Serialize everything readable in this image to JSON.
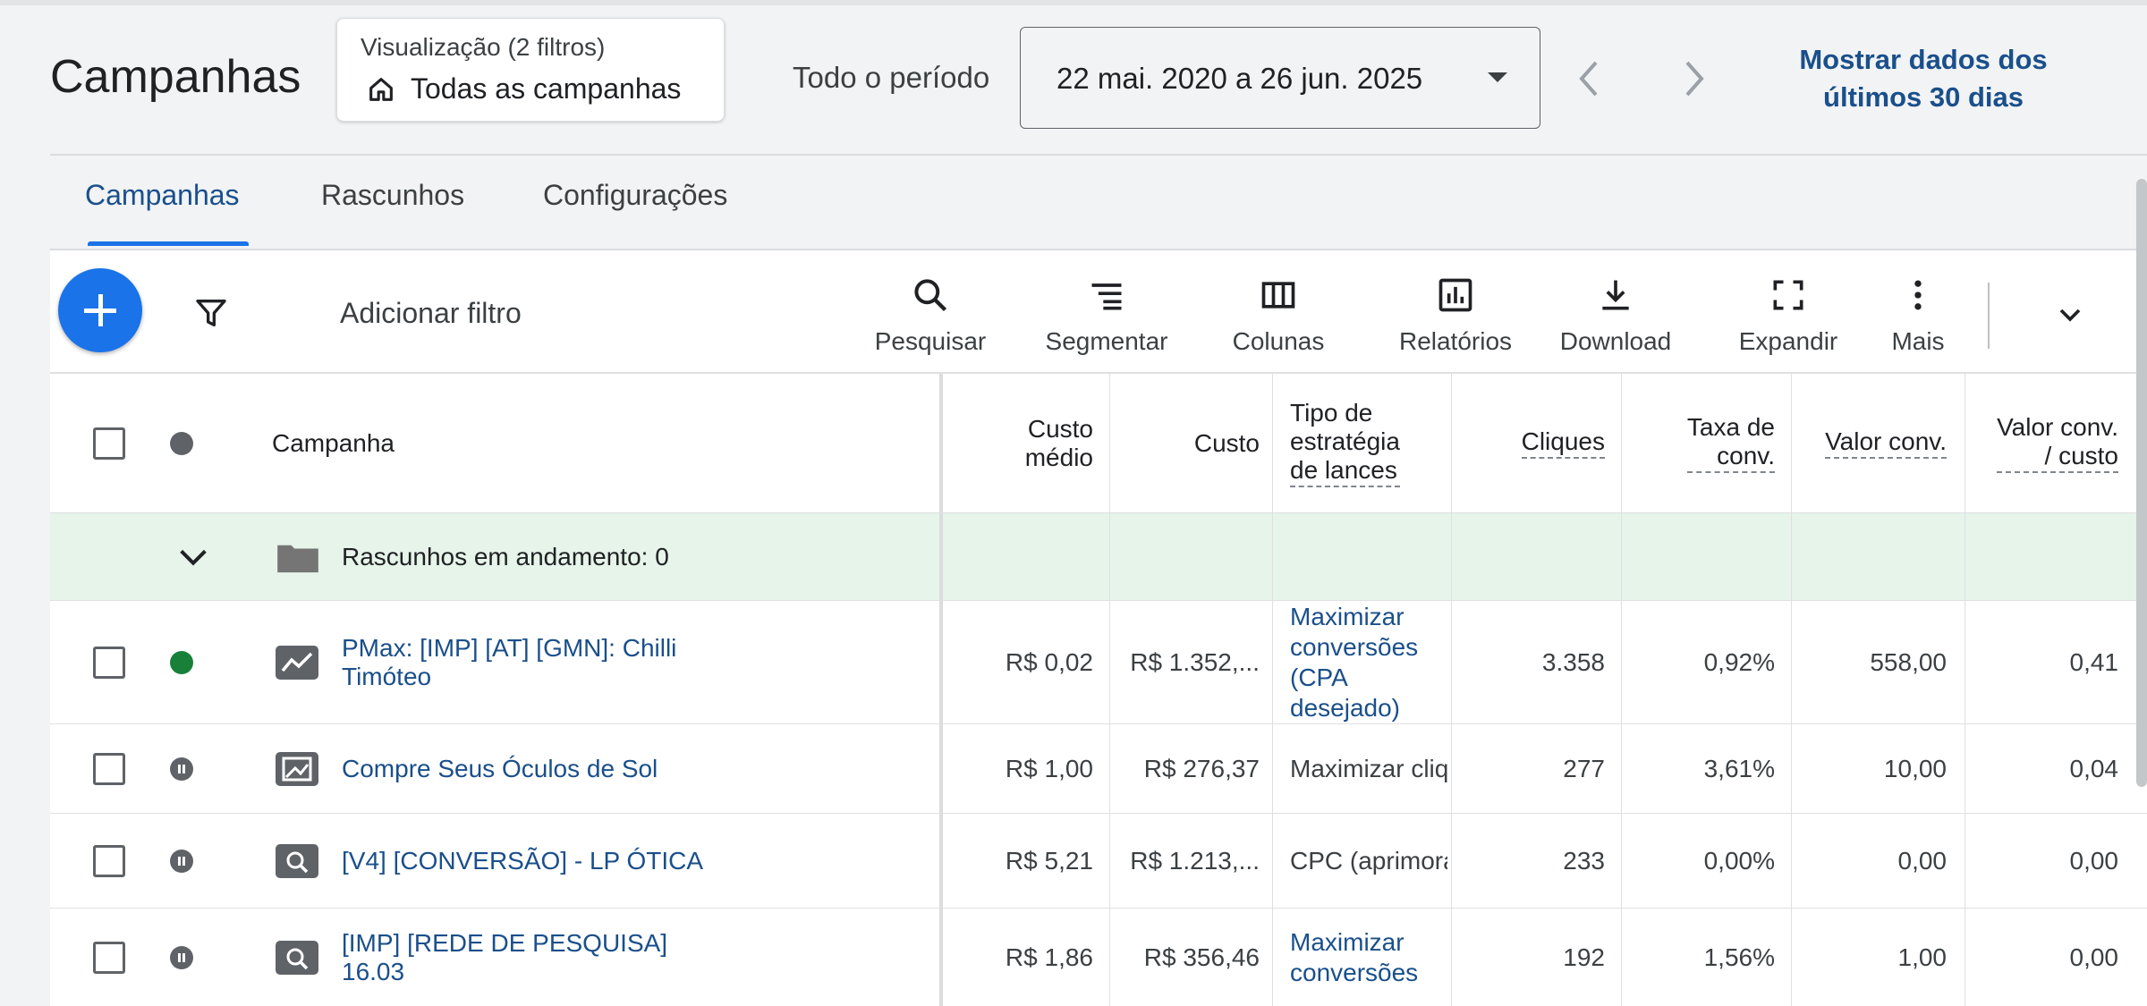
{
  "header": {
    "title": "Campanhas",
    "view_label": "Visualização (2 filtros)",
    "view_value": "Todas as campanhas",
    "period_label": "Todo o período",
    "date_range": "22 mai. 2020 a 26 jun. 2025",
    "last30_line1": "Mostrar dados dos",
    "last30_line2": "últimos 30 dias"
  },
  "tabs": [
    "Campanhas",
    "Rascunhos",
    "Configurações"
  ],
  "active_tab": "Campanhas",
  "toolbar": {
    "add_filter": "Adicionar filtro",
    "tools": [
      "Pesquisar",
      "Segmentar",
      "Colunas",
      "Relatórios",
      "Download",
      "Expandir",
      "Mais"
    ]
  },
  "columns": {
    "campaign": "Campanha",
    "avg_cost_1": "Custo",
    "avg_cost_2": "médio",
    "cost": "Custo",
    "strategy_1": "Tipo de",
    "strategy_2": "estratégia",
    "strategy_3": "de lances",
    "clicks": "Cliques",
    "conv_rate_1": "Taxa de",
    "conv_rate_2": "conv.",
    "conv_value": "Valor conv.",
    "conv_value_cost_1": "Valor conv.",
    "conv_value_cost_2": "/ custo"
  },
  "drafts": {
    "label": "Rascunhos em andamento: 0"
  },
  "rows": [
    {
      "name_1": "PMax: [IMP] [AT] [GMN]: Chilli",
      "name_2": "Timóteo",
      "status": "enabled",
      "type": "performance-max",
      "avg_cost": "R$ 0,02",
      "cost": "R$ 1.352,...",
      "strategy_1": "Maximizar",
      "strategy_2": "conversões",
      "strategy_3": "(CPA",
      "strategy_4": "desejado)",
      "clicks": "3.358",
      "conv_rate": "0,92%",
      "conv_value": "558,00",
      "conv_value_cost": "0,41"
    },
    {
      "name_1": "Compre Seus Óculos de Sol",
      "status": "paused",
      "type": "display",
      "avg_cost": "R$ 1,00",
      "cost": "R$ 276,37",
      "strategy_1": "Maximizar cliq",
      "clicks": "277",
      "conv_rate": "3,61%",
      "conv_value": "10,00",
      "conv_value_cost": "0,04"
    },
    {
      "name_1": "[V4] [CONVERSÃO] - LP ÓTICA",
      "status": "paused",
      "type": "search",
      "avg_cost": "R$ 5,21",
      "cost": "R$ 1.213,...",
      "strategy_1": "CPC (aprimora",
      "clicks": "233",
      "conv_rate": "0,00%",
      "conv_value": "0,00",
      "conv_value_cost": "0,00"
    },
    {
      "name_1": "[IMP] [REDE DE PESQUISA]",
      "name_2": "16.03",
      "status": "paused",
      "type": "search",
      "avg_cost": "R$ 1,86",
      "cost": "R$ 356,46",
      "strategy_1": "Maximizar",
      "strategy_2": "conversões",
      "clicks": "192",
      "conv_rate": "1,56%",
      "conv_value": "1,00",
      "conv_value_cost": "0,00"
    }
  ],
  "colors": {
    "accent": "#1a73e8",
    "link": "#1a4f8b",
    "enabled": "#188038",
    "drafts_bg": "#e6f4ea"
  }
}
